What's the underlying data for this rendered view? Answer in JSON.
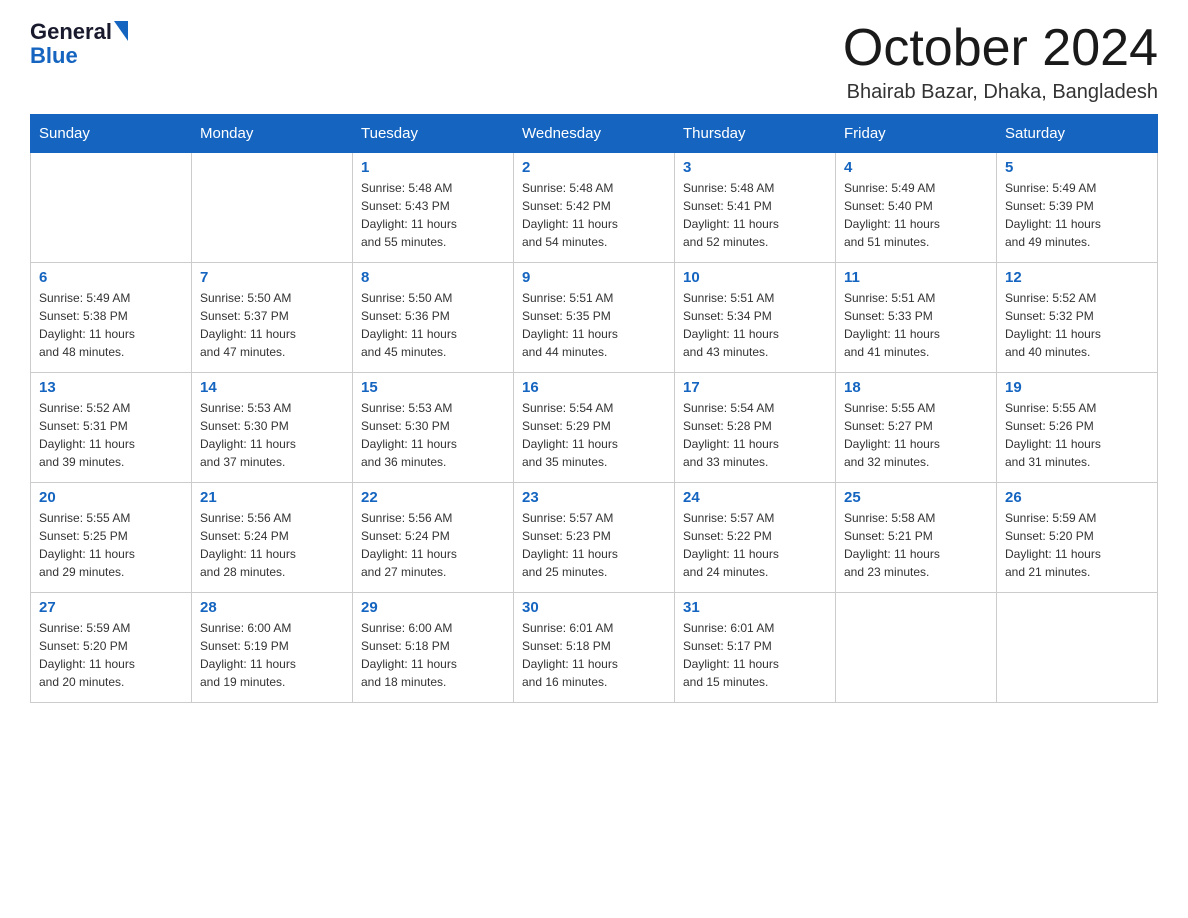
{
  "header": {
    "logo_general": "General",
    "logo_blue": "Blue",
    "title": "October 2024",
    "location": "Bhairab Bazar, Dhaka, Bangladesh"
  },
  "days_of_week": [
    "Sunday",
    "Monday",
    "Tuesday",
    "Wednesday",
    "Thursday",
    "Friday",
    "Saturday"
  ],
  "weeks": [
    [
      {
        "day": "",
        "info": ""
      },
      {
        "day": "",
        "info": ""
      },
      {
        "day": "1",
        "info": "Sunrise: 5:48 AM\nSunset: 5:43 PM\nDaylight: 11 hours\nand 55 minutes."
      },
      {
        "day": "2",
        "info": "Sunrise: 5:48 AM\nSunset: 5:42 PM\nDaylight: 11 hours\nand 54 minutes."
      },
      {
        "day": "3",
        "info": "Sunrise: 5:48 AM\nSunset: 5:41 PM\nDaylight: 11 hours\nand 52 minutes."
      },
      {
        "day": "4",
        "info": "Sunrise: 5:49 AM\nSunset: 5:40 PM\nDaylight: 11 hours\nand 51 minutes."
      },
      {
        "day": "5",
        "info": "Sunrise: 5:49 AM\nSunset: 5:39 PM\nDaylight: 11 hours\nand 49 minutes."
      }
    ],
    [
      {
        "day": "6",
        "info": "Sunrise: 5:49 AM\nSunset: 5:38 PM\nDaylight: 11 hours\nand 48 minutes."
      },
      {
        "day": "7",
        "info": "Sunrise: 5:50 AM\nSunset: 5:37 PM\nDaylight: 11 hours\nand 47 minutes."
      },
      {
        "day": "8",
        "info": "Sunrise: 5:50 AM\nSunset: 5:36 PM\nDaylight: 11 hours\nand 45 minutes."
      },
      {
        "day": "9",
        "info": "Sunrise: 5:51 AM\nSunset: 5:35 PM\nDaylight: 11 hours\nand 44 minutes."
      },
      {
        "day": "10",
        "info": "Sunrise: 5:51 AM\nSunset: 5:34 PM\nDaylight: 11 hours\nand 43 minutes."
      },
      {
        "day": "11",
        "info": "Sunrise: 5:51 AM\nSunset: 5:33 PM\nDaylight: 11 hours\nand 41 minutes."
      },
      {
        "day": "12",
        "info": "Sunrise: 5:52 AM\nSunset: 5:32 PM\nDaylight: 11 hours\nand 40 minutes."
      }
    ],
    [
      {
        "day": "13",
        "info": "Sunrise: 5:52 AM\nSunset: 5:31 PM\nDaylight: 11 hours\nand 39 minutes."
      },
      {
        "day": "14",
        "info": "Sunrise: 5:53 AM\nSunset: 5:30 PM\nDaylight: 11 hours\nand 37 minutes."
      },
      {
        "day": "15",
        "info": "Sunrise: 5:53 AM\nSunset: 5:30 PM\nDaylight: 11 hours\nand 36 minutes."
      },
      {
        "day": "16",
        "info": "Sunrise: 5:54 AM\nSunset: 5:29 PM\nDaylight: 11 hours\nand 35 minutes."
      },
      {
        "day": "17",
        "info": "Sunrise: 5:54 AM\nSunset: 5:28 PM\nDaylight: 11 hours\nand 33 minutes."
      },
      {
        "day": "18",
        "info": "Sunrise: 5:55 AM\nSunset: 5:27 PM\nDaylight: 11 hours\nand 32 minutes."
      },
      {
        "day": "19",
        "info": "Sunrise: 5:55 AM\nSunset: 5:26 PM\nDaylight: 11 hours\nand 31 minutes."
      }
    ],
    [
      {
        "day": "20",
        "info": "Sunrise: 5:55 AM\nSunset: 5:25 PM\nDaylight: 11 hours\nand 29 minutes."
      },
      {
        "day": "21",
        "info": "Sunrise: 5:56 AM\nSunset: 5:24 PM\nDaylight: 11 hours\nand 28 minutes."
      },
      {
        "day": "22",
        "info": "Sunrise: 5:56 AM\nSunset: 5:24 PM\nDaylight: 11 hours\nand 27 minutes."
      },
      {
        "day": "23",
        "info": "Sunrise: 5:57 AM\nSunset: 5:23 PM\nDaylight: 11 hours\nand 25 minutes."
      },
      {
        "day": "24",
        "info": "Sunrise: 5:57 AM\nSunset: 5:22 PM\nDaylight: 11 hours\nand 24 minutes."
      },
      {
        "day": "25",
        "info": "Sunrise: 5:58 AM\nSunset: 5:21 PM\nDaylight: 11 hours\nand 23 minutes."
      },
      {
        "day": "26",
        "info": "Sunrise: 5:59 AM\nSunset: 5:20 PM\nDaylight: 11 hours\nand 21 minutes."
      }
    ],
    [
      {
        "day": "27",
        "info": "Sunrise: 5:59 AM\nSunset: 5:20 PM\nDaylight: 11 hours\nand 20 minutes."
      },
      {
        "day": "28",
        "info": "Sunrise: 6:00 AM\nSunset: 5:19 PM\nDaylight: 11 hours\nand 19 minutes."
      },
      {
        "day": "29",
        "info": "Sunrise: 6:00 AM\nSunset: 5:18 PM\nDaylight: 11 hours\nand 18 minutes."
      },
      {
        "day": "30",
        "info": "Sunrise: 6:01 AM\nSunset: 5:18 PM\nDaylight: 11 hours\nand 16 minutes."
      },
      {
        "day": "31",
        "info": "Sunrise: 6:01 AM\nSunset: 5:17 PM\nDaylight: 11 hours\nand 15 minutes."
      },
      {
        "day": "",
        "info": ""
      },
      {
        "day": "",
        "info": ""
      }
    ]
  ]
}
